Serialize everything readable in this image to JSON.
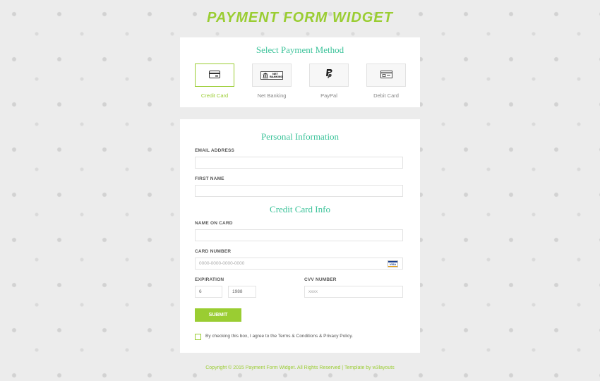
{
  "header": {
    "title": "PAYMENT FORM WIDGET"
  },
  "payment_method": {
    "heading": "Select Payment Method",
    "methods": [
      {
        "label": "Credit Card",
        "icon": "credit-card-icon",
        "selected": true
      },
      {
        "label": "Net Banking",
        "icon": "net-banking-icon",
        "icon_text": "NET BANKING",
        "selected": false
      },
      {
        "label": "PayPal",
        "icon": "paypal-icon",
        "selected": false
      },
      {
        "label": "Debit Card",
        "icon": "debit-card-icon",
        "selected": false
      }
    ]
  },
  "personal_info": {
    "heading": "Personal Information",
    "email_label": "EMAIL ADDRESS",
    "email_value": "",
    "first_name_label": "FIRST NAME",
    "first_name_value": ""
  },
  "card_info": {
    "heading": "Credit Card Info",
    "name_label": "NAME ON CARD",
    "name_value": "",
    "number_label": "CARD NUMBER",
    "number_placeholder": "0000-0000-0000-0000",
    "card_brand_text": "VISA",
    "expiration_label": "EXPIRATION",
    "expiration_month": "6",
    "expiration_year": "1988",
    "cvv_label": "CVV NUMBER",
    "cvv_placeholder": "xxxx"
  },
  "actions": {
    "submit_label": "SUBMIT",
    "agree_text": "By checking this box, I agree to the Terms & Conditions & Privacy Policy."
  },
  "footer": {
    "text": "Copyright © 2015 Payment Form Widget. All Rights Reserved | Template by w3layouts"
  },
  "colors": {
    "accent": "#9acd32",
    "heading": "#3cc39a",
    "background": "#ececec"
  }
}
